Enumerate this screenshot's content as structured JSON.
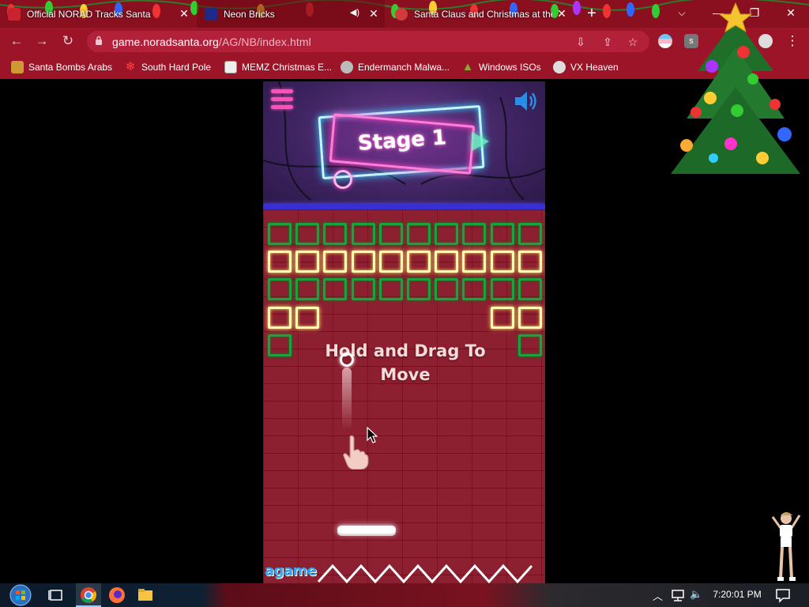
{
  "browser": {
    "tabs": [
      {
        "title": "Official NORAD Tracks Santa",
        "active": false,
        "favicon": "norad-favicon-icon"
      },
      {
        "title": "Neon Bricks",
        "active": true,
        "favicon": "flag-favicon-icon",
        "audio": true
      },
      {
        "title": "Santa Claus and Christmas at the",
        "active": false,
        "favicon": "santa-favicon-icon"
      }
    ],
    "new_tab": "+",
    "url_host": "game.noradsanta.org",
    "url_path": "/AG/NB/index.html",
    "bookmarks": [
      {
        "label": "Santa Bombs Arabs",
        "icon": "santa-bookmark-icon"
      },
      {
        "label": "South Hard Pole",
        "icon": "snowflake-bookmark-icon"
      },
      {
        "label": "MEMZ Christmas E...",
        "icon": "image-bookmark-icon"
      },
      {
        "label": "Endermanch Malwa...",
        "icon": "raccoon-bookmark-icon"
      },
      {
        "label": "Windows ISOs",
        "icon": "tree-bookmark-icon"
      },
      {
        "label": "VX Heaven",
        "icon": "vx-bookmark-icon"
      }
    ]
  },
  "game": {
    "stage_title": "Stage 1",
    "hint": "Hold and Drag To Move",
    "logo": "agame",
    "colors": {
      "green_brick": "#1aa33c",
      "yellow_brick": "#fffbb0",
      "menu_pink": "#ff4fb8",
      "sound_blue": "#2a8de6"
    },
    "bricks": {
      "columns": 10,
      "rows": [
        {
          "type": "green",
          "present": [
            true,
            true,
            true,
            true,
            true,
            true,
            true,
            true,
            true,
            true
          ]
        },
        {
          "type": "yellow",
          "present": [
            true,
            true,
            true,
            true,
            true,
            true,
            true,
            true,
            true,
            true
          ]
        },
        {
          "type": "green",
          "present": [
            true,
            true,
            true,
            true,
            true,
            true,
            true,
            true,
            true,
            true
          ]
        },
        {
          "type": "yellow",
          "present": [
            true,
            true,
            false,
            false,
            false,
            false,
            false,
            false,
            true,
            true
          ]
        },
        {
          "type": "green",
          "present": [
            true,
            false,
            false,
            false,
            false,
            false,
            false,
            false,
            false,
            true
          ]
        }
      ]
    }
  },
  "taskbar": {
    "clock": "7:20:01 PM",
    "icons": [
      "windows-start-icon",
      "task-view-icon",
      "chrome-icon",
      "firefox-icon",
      "file-explorer-icon"
    ],
    "tray": [
      "chevron-up-icon",
      "network-icon",
      "volume-icon",
      "notification-icon"
    ]
  }
}
